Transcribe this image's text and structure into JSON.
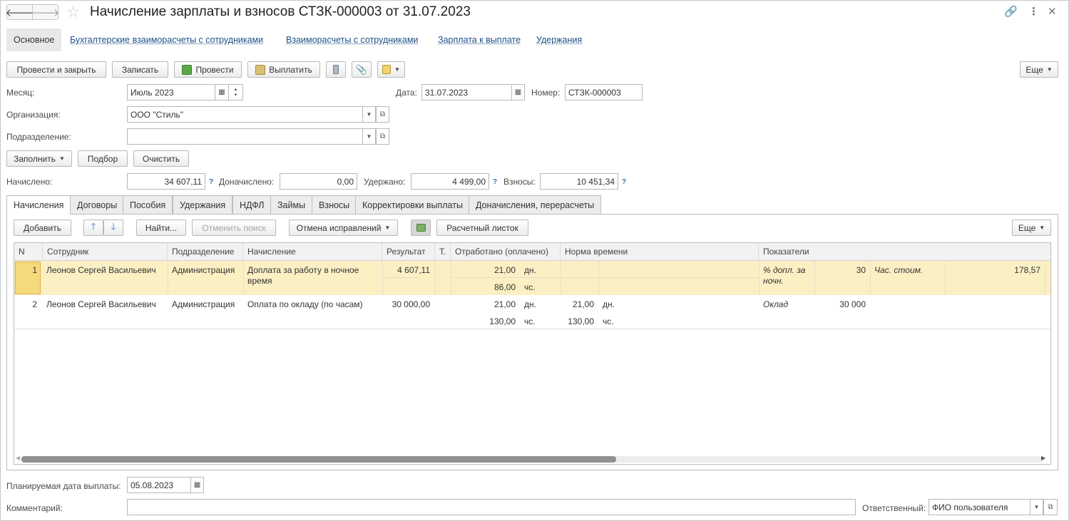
{
  "title": "Начисление зарплаты и взносов СТЗК-000003 от 31.07.2023",
  "sections": {
    "main": "Основное",
    "links": [
      "Бухгалтерские взаиморасчеты с сотрудниками",
      "Взаиморасчеты с сотрудниками",
      "Зарплата к выплате",
      "Удержания"
    ]
  },
  "toolbar": {
    "post_close": "Провести и закрыть",
    "save": "Записать",
    "post": "Провести",
    "pay": "Выплатить",
    "more": "Еще"
  },
  "fields": {
    "month_label": "Месяц:",
    "month_value": "Июль 2023",
    "date_label": "Дата:",
    "date_value": "31.07.2023",
    "number_label": "Номер:",
    "number_value": "СТЗК-000003",
    "org_label": "Организация:",
    "org_value": "ООО \"Стиль\"",
    "dept_label": "Подразделение:",
    "dept_value": ""
  },
  "actions": {
    "fill": "Заполнить",
    "pick": "Подбор",
    "clear": "Очистить"
  },
  "totals": {
    "accrued_label": "Начислено:",
    "accrued_value": "34 607,11",
    "extra_label": "Доначислено:",
    "extra_value": "0,00",
    "withheld_label": "Удержано:",
    "withheld_value": "4 499,00",
    "contrib_label": "Взносы:",
    "contrib_value": "10 451,34",
    "help": "?"
  },
  "tabs": [
    "Начисления",
    "Договоры",
    "Пособия",
    "Удержания",
    "НДФЛ",
    "Займы",
    "Взносы",
    "Корректировки выплаты",
    "Доначисления, перерасчеты"
  ],
  "table_toolbar": {
    "add": "Добавить",
    "find": "Найти...",
    "cancel_search": "Отменить поиск",
    "cancel_fix": "Отмена исправлений",
    "payslip": "Расчетный листок",
    "more": "Еще"
  },
  "table": {
    "columns": [
      "N",
      "Сотрудник",
      "Подразделение",
      "Начисление",
      "Результат",
      "Т.",
      "Отработано (оплачено)",
      "Норма времени",
      "Показатели"
    ],
    "rows": [
      {
        "n": "1",
        "employee": "Леонов Сергей Васильевич",
        "dept": "Администрация",
        "accrual_line1": "Доплата за работу в ночное",
        "accrual_line2": "время",
        "result": "4 607,11",
        "worked_days": "21,00",
        "days_unit": "дн.",
        "worked_hours": "86,00",
        "hours_unit": "чс.",
        "norm_days": "",
        "norm_hours": "",
        "ind1_name_line1": "% допл. за",
        "ind1_name_line2": "ночн.",
        "ind1_value": "30",
        "ind2_name": "Час. стоим.",
        "ind2_value": "178,57"
      },
      {
        "n": "2",
        "employee": "Леонов Сергей Васильевич",
        "dept": "Администрация",
        "accrual_line1": "Оплата по окладу (по часам)",
        "result": "30 000,00",
        "worked_days": "21,00",
        "days_unit": "дн.",
        "worked_hours": "130,00",
        "hours_unit": "чс.",
        "norm_days": "21,00",
        "norm_days_unit": "дн.",
        "norm_hours": "130,00",
        "norm_hours_unit": "чс.",
        "ind1_name": "Оклад",
        "ind1_value": "30 000"
      }
    ]
  },
  "footer": {
    "pay_date_label": "Планируемая дата выплаты:",
    "pay_date_value": "05.08.2023",
    "comment_label": "Комментарий:",
    "comment_value": "",
    "responsible_label": "Ответственный:",
    "responsible_value": "ФИО пользователя"
  },
  "colors": {
    "link": "#1c4f86",
    "selected_row": "#fbf0c4",
    "help_mark": "#2e6bb0"
  }
}
